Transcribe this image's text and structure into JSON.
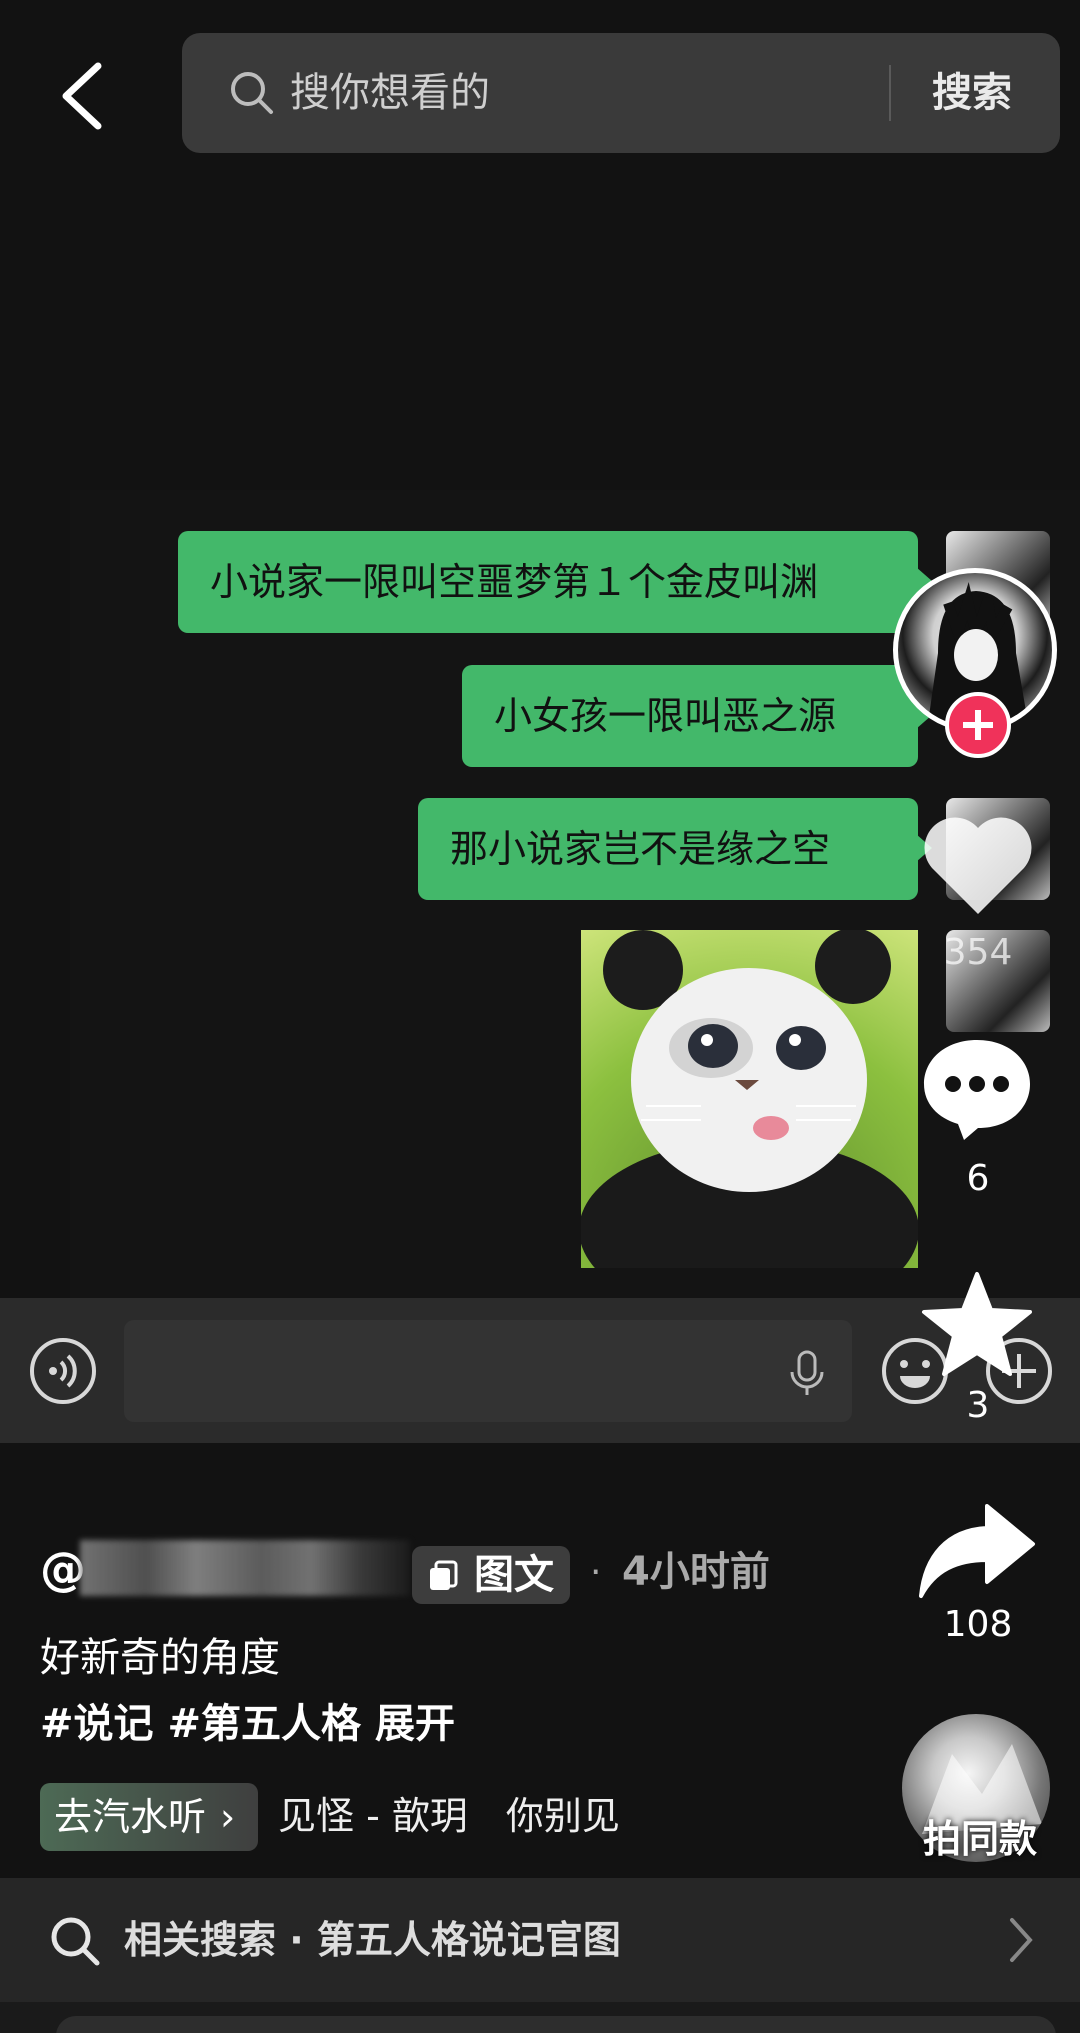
{
  "search": {
    "placeholder": "搜你想看的",
    "button_label": "搜索"
  },
  "chat": {
    "messages": [
      "小说家一限叫空噩梦第１个金皮叫渊",
      "小女孩一限叫恶之源",
      "那小说家岂不是缘之空"
    ],
    "sticker_icon": "panda-cat-sticker"
  },
  "actions": {
    "like_count": "354",
    "comment_count": "6",
    "favorite_count": "3",
    "share_count": "108",
    "same_style_label": "拍同款",
    "accent_color": "#f0325a"
  },
  "post": {
    "at": "@",
    "type_label": "图文",
    "dot": "·",
    "time_ago": "4小时前",
    "description": "好新奇的角度",
    "tags": [
      "#说记",
      "#第五人格"
    ],
    "expand_label": "展开",
    "music_chip_label": "去汽水听",
    "music_chip_chevron": "›",
    "music_title": "见怪 - 歆玥　你别见"
  },
  "related": {
    "text": "相关搜索 · 第五人格说记官图"
  }
}
